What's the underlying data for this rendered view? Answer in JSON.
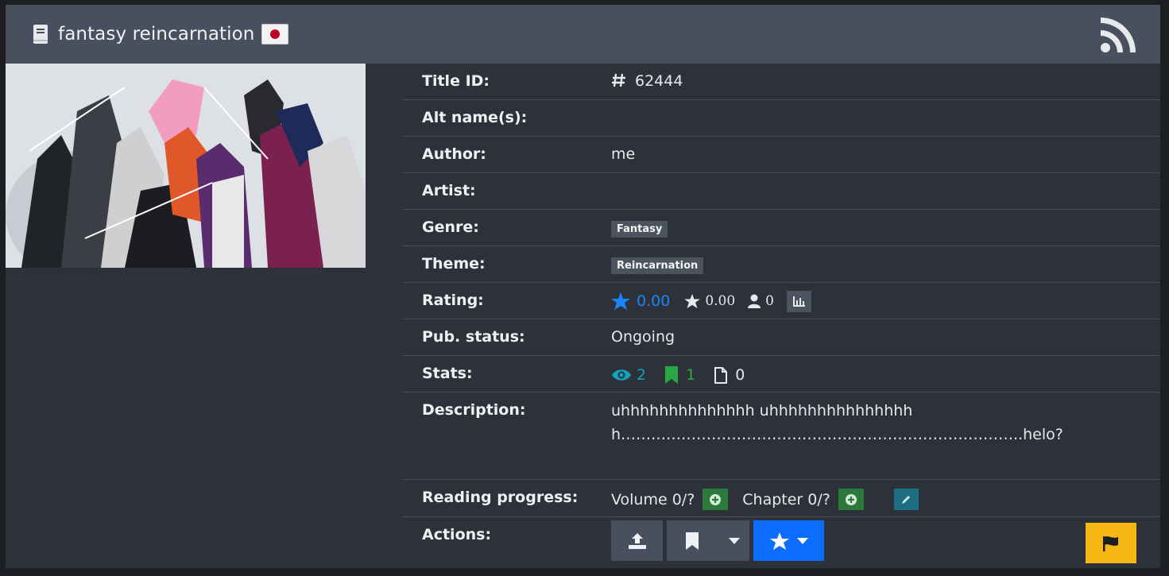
{
  "header": {
    "title": "fantasy reincarnation",
    "book_icon": "book-icon",
    "language_flag": "japan-flag",
    "rss_icon": "rss-icon"
  },
  "cover": {
    "alt": "cover-image"
  },
  "info": {
    "title_id_label": "Title ID:",
    "title_id_value": "62444",
    "alt_names_label": "Alt name(s):",
    "alt_names_value": "",
    "author_label": "Author:",
    "author_value": "me",
    "artist_label": "Artist:",
    "artist_value": "",
    "genre_label": "Genre:",
    "genres": [
      "Fantasy"
    ],
    "theme_label": "Theme:",
    "themes": [
      "Reincarnation"
    ],
    "rating_label": "Rating:",
    "rating_bayesian": "0.00",
    "rating_mean": "0.00",
    "rating_users": "0",
    "pub_status_label": "Pub. status:",
    "pub_status_value": "Ongoing",
    "stats_label": "Stats:",
    "stats_views": "2",
    "stats_follows": "1",
    "stats_chapters": "0",
    "description_label": "Description:",
    "description_value": "uhhhhhhhhhhhhhh uhhhhhhhhhhhhhhhh……………………………………………………………………..helo?",
    "reading_progress_label": "Reading progress:",
    "volume_text": "Volume 0/?",
    "chapter_text": "Chapter 0/?",
    "actions_label": "Actions:"
  },
  "colors": {
    "header_bg": "#48505f",
    "card_bg": "#2d3139",
    "accent_blue": "#1a84ff",
    "teal": "#17a2b8",
    "green": "#28a745",
    "report_yellow": "#f6b713"
  }
}
